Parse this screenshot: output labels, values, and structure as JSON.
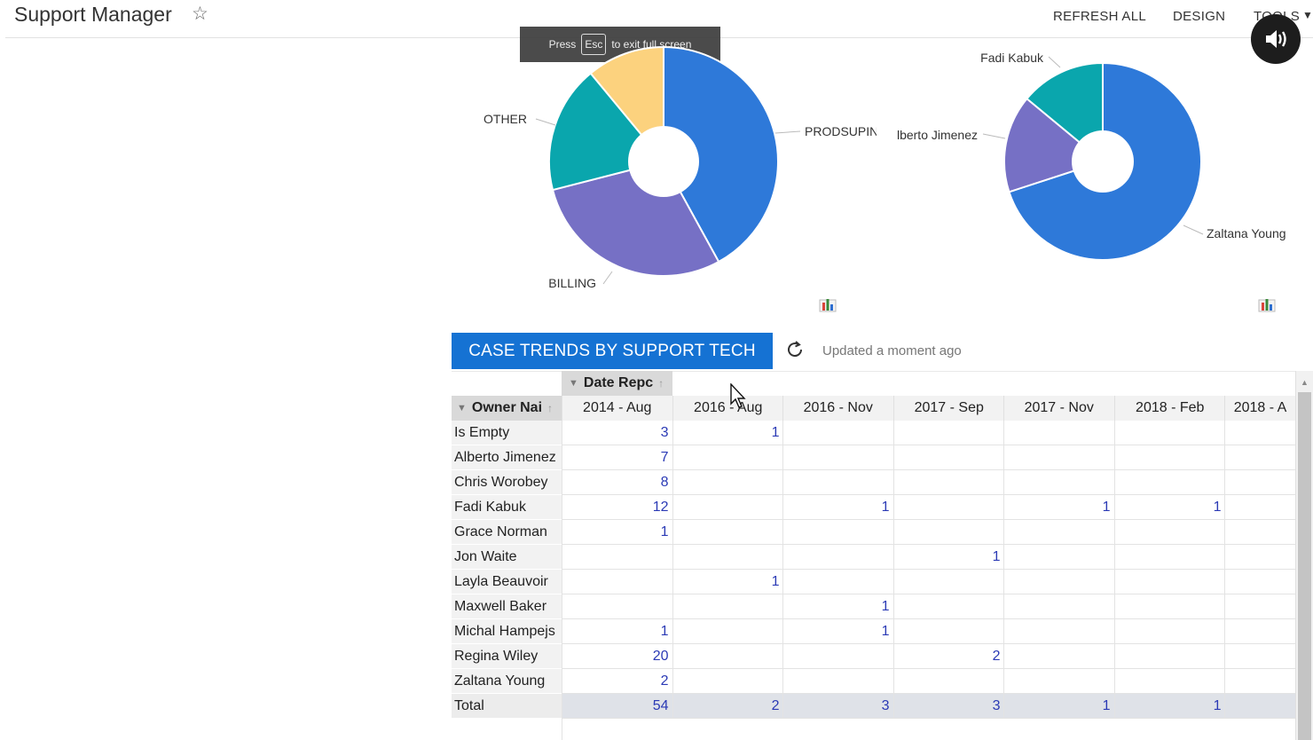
{
  "app": {
    "title": "Support Manager"
  },
  "menu": {
    "refresh_all": "REFRESH ALL",
    "design": "DESIGN",
    "tools": "TOOLS"
  },
  "fullscreen_notice": {
    "before": "Press",
    "key": "Esc",
    "after": "to exit full screen"
  },
  "pie1": {
    "labels": [
      "PRODSUPIN",
      "BILLING",
      "OTHER"
    ],
    "slices": [
      {
        "label": "PRODSUPIN",
        "fraction": 0.42,
        "color": "#2e79d9"
      },
      {
        "label": "BILLING",
        "fraction": 0.29,
        "color": "#7670c5"
      },
      {
        "label": "OTHER",
        "fraction": 0.18,
        "color": "#0aa6ad"
      },
      {
        "label": "",
        "fraction": 0.11,
        "color": "#fcd27e"
      }
    ]
  },
  "pie2": {
    "labels": [
      "Fadi Kabuk",
      "lberto Jimenez",
      "Zaltana Young"
    ],
    "slices": [
      {
        "label": "Zaltana Young",
        "fraction": 0.7,
        "color": "#2e79d9"
      },
      {
        "label": "Alberto Jimenez",
        "fraction": 0.16,
        "color": "#7670c5"
      },
      {
        "label": "Fadi Kabuk",
        "fraction": 0.14,
        "color": "#0aa6ad"
      }
    ]
  },
  "section": {
    "title": "CASE TRENDS BY SUPPORT TECH",
    "updated": "Updated a moment ago"
  },
  "grid": {
    "date_header": "Date Repc",
    "owner_header": "Owner Nai",
    "columns": [
      "2014 - Aug",
      "2016 - Aug",
      "2016 - Nov",
      "2017 - Sep",
      "2017 - Nov",
      "2018 - Feb",
      "2018 - A"
    ],
    "rows": [
      {
        "name": "Is Empty",
        "values": [
          "3",
          "1",
          "",
          "",
          "",
          "",
          ""
        ]
      },
      {
        "name": "Alberto Jimenez",
        "values": [
          "7",
          "",
          "",
          "",
          "",
          "",
          ""
        ]
      },
      {
        "name": "Chris Worobey",
        "values": [
          "8",
          "",
          "",
          "",
          "",
          "",
          ""
        ]
      },
      {
        "name": "Fadi Kabuk",
        "values": [
          "12",
          "",
          "1",
          "",
          "1",
          "1",
          ""
        ]
      },
      {
        "name": "Grace Norman",
        "values": [
          "1",
          "",
          "",
          "",
          "",
          "",
          ""
        ]
      },
      {
        "name": "Jon Waite",
        "values": [
          "",
          "",
          "",
          "1",
          "",
          "",
          ""
        ]
      },
      {
        "name": "Layla Beauvoir",
        "values": [
          "",
          "1",
          "",
          "",
          "",
          "",
          ""
        ]
      },
      {
        "name": "Maxwell Baker",
        "values": [
          "",
          "",
          "1",
          "",
          "",
          "",
          ""
        ]
      },
      {
        "name": "Michal Hampejs",
        "values": [
          "1",
          "",
          "1",
          "",
          "",
          "",
          ""
        ]
      },
      {
        "name": "Regina Wiley",
        "values": [
          "20",
          "",
          "",
          "2",
          "",
          "",
          ""
        ]
      },
      {
        "name": "Zaltana Young",
        "values": [
          "2",
          "",
          "",
          "",
          "",
          "",
          ""
        ]
      }
    ],
    "total": {
      "name": "Total",
      "values": [
        "54",
        "2",
        "3",
        "3",
        "1",
        "1",
        ""
      ]
    }
  },
  "icons": {
    "star": "star-outline-icon",
    "sound": "speaker-icon",
    "chart": "bar-chart-icon",
    "refresh": "refresh-icon",
    "filter": "funnel-icon",
    "sort": "sort-arrow-icon"
  }
}
